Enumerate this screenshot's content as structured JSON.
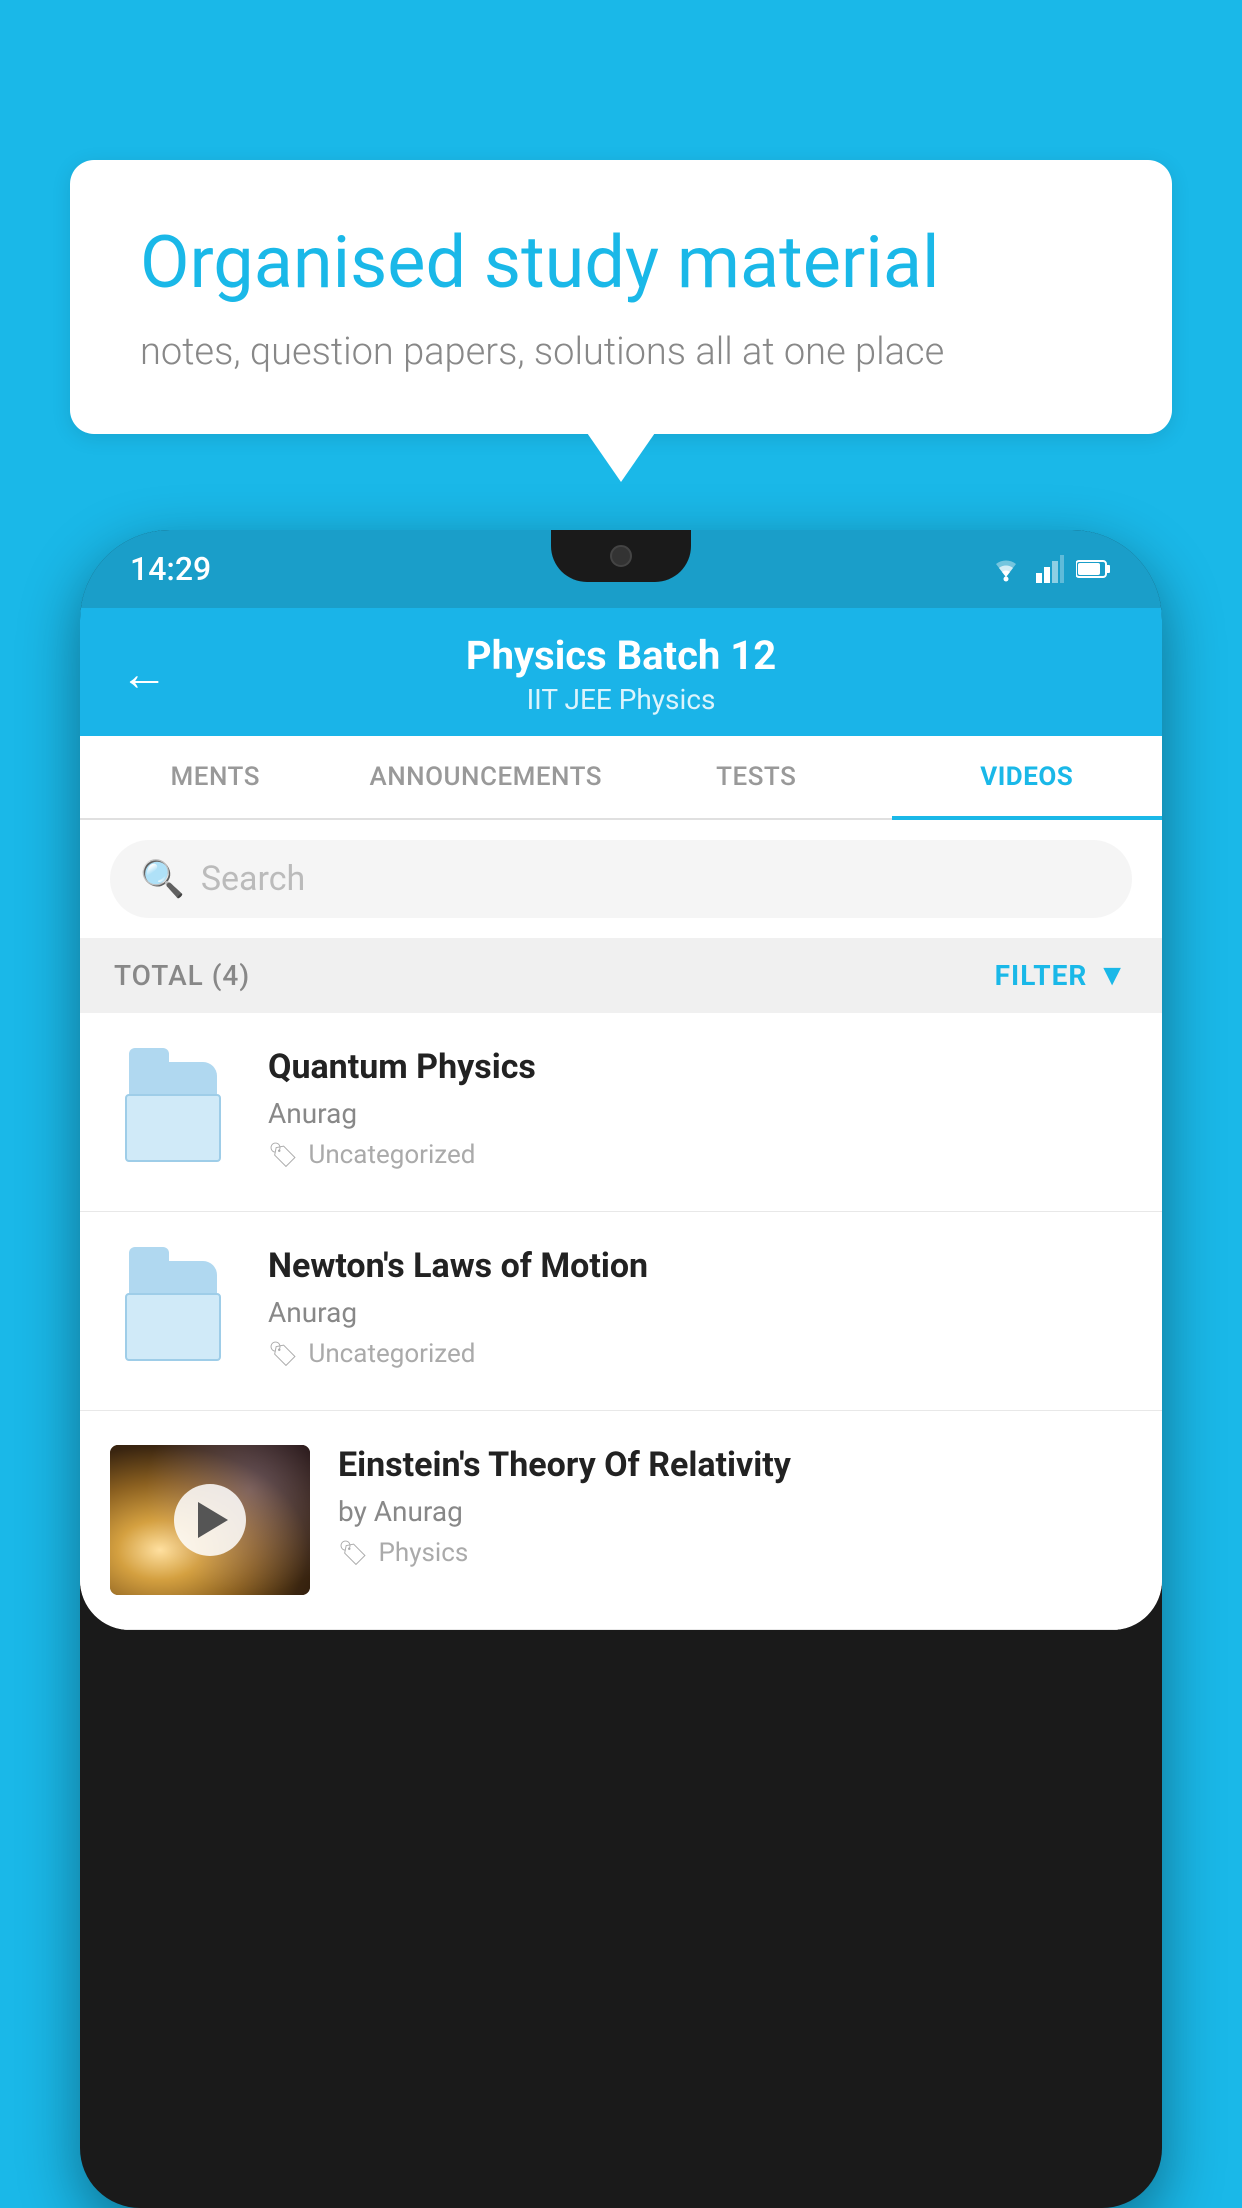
{
  "background_color": "#1ab8e8",
  "speech_bubble": {
    "title": "Organised study material",
    "subtitle": "notes, question papers, solutions all at one place"
  },
  "phone": {
    "status_bar": {
      "time": "14:29"
    },
    "header": {
      "title": "Physics Batch 12",
      "subtitle": "IIT JEE   Physics",
      "back_label": "←"
    },
    "tabs": [
      {
        "label": "MENTS",
        "active": false
      },
      {
        "label": "ANNOUNCEMENTS",
        "active": false
      },
      {
        "label": "TESTS",
        "active": false
      },
      {
        "label": "VIDEOS",
        "active": true
      }
    ],
    "search": {
      "placeholder": "Search"
    },
    "filter_bar": {
      "total_label": "TOTAL (4)",
      "filter_label": "FILTER"
    },
    "videos": [
      {
        "title": "Quantum Physics",
        "author": "Anurag",
        "tag": "Uncategorized",
        "type": "folder"
      },
      {
        "title": "Newton's Laws of Motion",
        "author": "Anurag",
        "tag": "Uncategorized",
        "type": "folder"
      },
      {
        "title": "Einstein's Theory Of Relativity",
        "author": "by Anurag",
        "tag": "Physics",
        "type": "video"
      }
    ]
  }
}
